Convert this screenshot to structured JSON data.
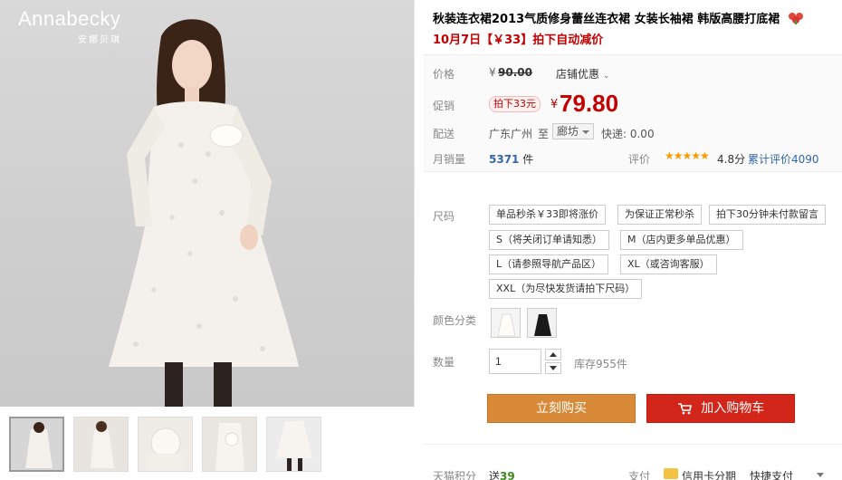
{
  "brand": {
    "name": "Annabecky",
    "name_cn": "安娜贝琪"
  },
  "product": {
    "title": "秋装连衣裙2013气质修身蕾丝连衣裙 女装长袖裙 韩版高腰打底裙",
    "subtitle": "10月7日【￥33】拍下自动减价"
  },
  "price": {
    "label": "价格",
    "currency": "¥",
    "original": "90.00",
    "shop_promo": "店铺优惠",
    "promo_label": "促销",
    "promo_badge": "拍下33元",
    "promo_price": "79.80"
  },
  "shipping": {
    "label": "配送",
    "from": "广东广州",
    "to_word": "至",
    "to_city": "廊坊",
    "fee": "快递: 0.00"
  },
  "sales": {
    "label": "月销量",
    "count": "5371",
    "unit": "件",
    "rating_label": "评价",
    "stars": "★★★★★",
    "score": "4.8分",
    "total_reviews": "累计评价4090"
  },
  "sizes": {
    "label": "尺码",
    "options": [
      "单品秒杀￥33即将涨价",
      "为保证正常秒杀",
      "拍下30分钟未付款留言",
      "S（将关闭订单请知悉）",
      "M（店内更多单品优惠）",
      "L（请参照导航产品区）",
      "XL（或咨询客服）",
      "XXL（为尽快发货请拍下尺码）"
    ]
  },
  "colors": {
    "label": "颜色分类"
  },
  "quantity": {
    "label": "数量",
    "value": "1",
    "stock": "库存955件"
  },
  "actions": {
    "buy_now": "立刻购买",
    "add_to_cart": "加入购物车"
  },
  "footer": {
    "points_label": "天猫积分",
    "points_prefix": "送",
    "points_value": "39",
    "pay_label": "支付",
    "card_pay": "信用卡分期",
    "quick_pay": "快捷支付"
  }
}
